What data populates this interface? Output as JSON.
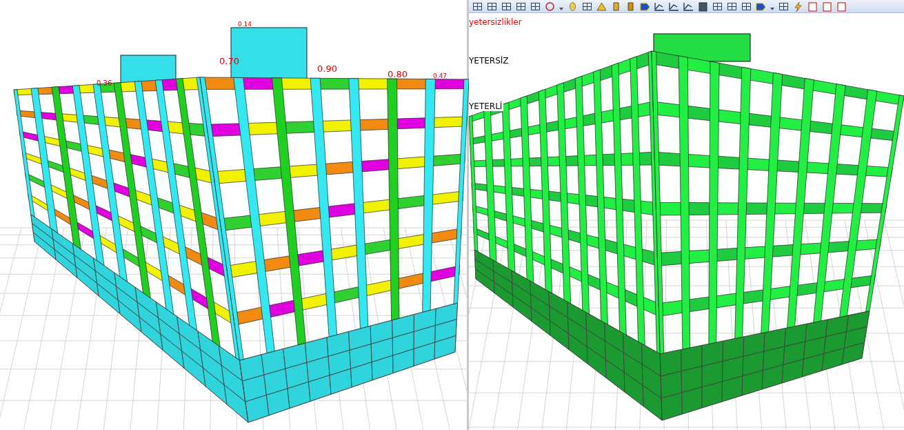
{
  "left_view": {
    "labels": [
      {
        "text": "0.14"
      },
      {
        "text": "0.70"
      },
      {
        "text": "0.90"
      },
      {
        "text": "0.80"
      },
      {
        "text": "0.36"
      },
      {
        "text": "0.47"
      }
    ]
  },
  "right_view": {
    "legend": [
      {
        "text": "yetersizlikler",
        "kind": "title"
      },
      {
        "text": "YETERSİZ",
        "kind": "status"
      },
      {
        "text": "YETERLİ",
        "kind": "status"
      }
    ]
  }
}
